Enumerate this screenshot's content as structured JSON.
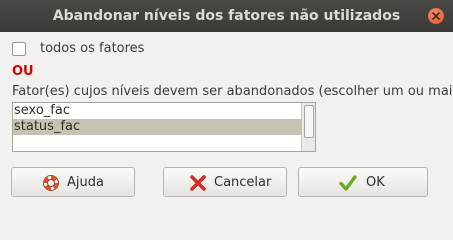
{
  "window": {
    "title": "Abandonar níveis dos fatores não utilizados"
  },
  "all_factors": {
    "label": "todos os fatores",
    "checked": false
  },
  "or_label": "OU",
  "factor_list": {
    "heading": "Fator(es) cujos níveis devem ser abandonados (escolher um ou mais)",
    "items": [
      {
        "label": "sexo_fac",
        "selected": false
      },
      {
        "label": "status_fac",
        "selected": true
      }
    ]
  },
  "buttons": {
    "help": "Ajuda",
    "cancel": "Cancelar",
    "ok": "OK"
  },
  "icons": {
    "close": "close-icon",
    "help": "lifebuoy-icon",
    "cancel": "x-mark-icon",
    "ok": "checkmark-icon"
  },
  "colors": {
    "titlebar": "#3c3b37",
    "close": "#e9632f",
    "or_label": "#d40000",
    "selection": "#c8c2b3",
    "cancel_icon": "#d42a2a",
    "ok_icon": "#6aaa1e"
  }
}
